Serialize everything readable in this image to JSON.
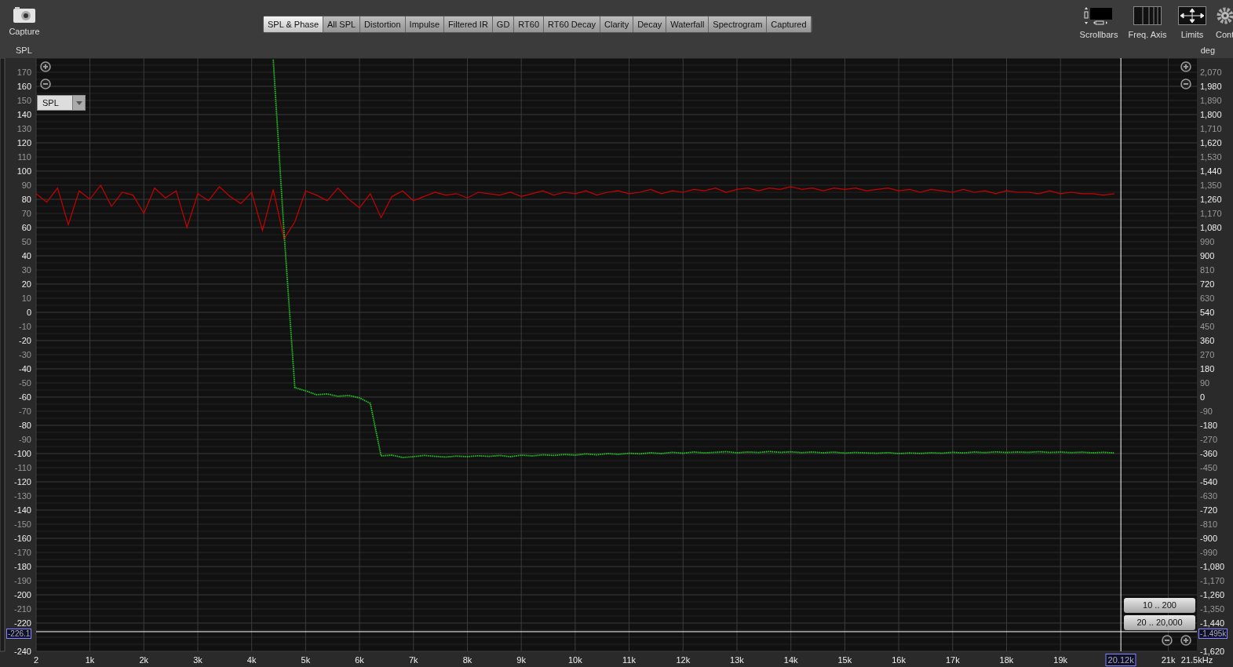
{
  "capture": {
    "label": "Capture"
  },
  "tabs": [
    {
      "label": "SPL & Phase",
      "selected": true
    },
    {
      "label": "All SPL",
      "selected": false
    },
    {
      "label": "Distortion",
      "selected": false
    },
    {
      "label": "Impulse",
      "selected": false
    },
    {
      "label": "Filtered IR",
      "selected": false
    },
    {
      "label": "GD",
      "selected": false
    },
    {
      "label": "RT60",
      "selected": false
    },
    {
      "label": "RT60 Decay",
      "selected": false
    },
    {
      "label": "Clarity",
      "selected": false
    },
    {
      "label": "Decay",
      "selected": false
    },
    {
      "label": "Waterfall",
      "selected": false
    },
    {
      "label": "Spectrogram",
      "selected": false
    },
    {
      "label": "Captured",
      "selected": false
    }
  ],
  "toolbar": [
    {
      "kind": "scrollbars",
      "label": "Scrollbars"
    },
    {
      "kind": "freq-axis",
      "label": "Freq. Axis"
    },
    {
      "kind": "limits",
      "label": "Limits"
    },
    {
      "kind": "controls",
      "label": "Cont"
    }
  ],
  "trace_select": {
    "value": "SPL"
  },
  "range_buttons": [
    "10 .. 200",
    "20 .. 20,000"
  ],
  "chart_data": {
    "type": "line",
    "ylabel": "SPL",
    "y2label": "deg",
    "xlim": [
      2,
      21530
    ],
    "ylim": [
      -240,
      180
    ],
    "y2lim": [
      -1620,
      2160
    ],
    "x": [
      2,
      200,
      400,
      600,
      800,
      1000,
      1200,
      1400,
      1600,
      1800,
      2000,
      2200,
      2400,
      2600,
      2800,
      3000,
      3200,
      3400,
      3600,
      3800,
      4000,
      4200,
      4400,
      4600,
      4800,
      5000,
      5200,
      5400,
      5600,
      5800,
      6000,
      6200,
      6400,
      6600,
      6800,
      7000,
      7200,
      7400,
      7600,
      7800,
      8000,
      8200,
      8400,
      8600,
      8800,
      9000,
      9200,
      9400,
      9600,
      9800,
      10000,
      10200,
      10400,
      10600,
      10800,
      11000,
      11200,
      11400,
      11600,
      11800,
      12000,
      12200,
      12400,
      12600,
      12800,
      13000,
      13200,
      13400,
      13600,
      13800,
      14000,
      14200,
      14400,
      14600,
      14800,
      15000,
      15200,
      15400,
      15600,
      15800,
      16000,
      16200,
      16400,
      16600,
      16800,
      17000,
      17200,
      17400,
      17600,
      17800,
      18000,
      18200,
      18400,
      18600,
      18800,
      19000,
      19200,
      19400,
      19600,
      19800,
      20000
    ],
    "series": [
      {
        "color": "#cc0000",
        "values": [
          84,
          78,
          88,
          62,
          86,
          80,
          90,
          75,
          85,
          83,
          70,
          88,
          81,
          86,
          60,
          84,
          79,
          89,
          82,
          77,
          85,
          58,
          87,
          52,
          64,
          86,
          83,
          79,
          88,
          80,
          74,
          84,
          67,
          82,
          86,
          79,
          82,
          85,
          83,
          84,
          81,
          85,
          84,
          83,
          85,
          82,
          84,
          86,
          83,
          85,
          84,
          86,
          83,
          85,
          86,
          84,
          85,
          87,
          84,
          86,
          85,
          87,
          86,
          88,
          85,
          87,
          88,
          86,
          88,
          87,
          89,
          87,
          88,
          86,
          88,
          87,
          88,
          86,
          87,
          88,
          86,
          87,
          85,
          87,
          86,
          85,
          87,
          85,
          86,
          84,
          86,
          85,
          85,
          84,
          86,
          84,
          85,
          84,
          84,
          83,
          84
        ]
      },
      {
        "axis": "y2",
        "color": "#22cc22",
        "line_style": "dotted",
        "values": [
          null,
          null,
          null,
          null,
          null,
          null,
          null,
          null,
          null,
          null,
          null,
          null,
          null,
          null,
          null,
          null,
          null,
          null,
          null,
          null,
          null,
          null,
          2150,
          1050,
          60,
          40,
          15,
          20,
          5,
          10,
          -5,
          -40,
          -375,
          -370,
          -385,
          -380,
          -372,
          -378,
          -382,
          -376,
          -380,
          -374,
          -378,
          -372,
          -380,
          -370,
          -375,
          -368,
          -372,
          -366,
          -370,
          -362,
          -368,
          -360,
          -365,
          -358,
          -362,
          -355,
          -360,
          -352,
          -358,
          -350,
          -356,
          -352,
          -348,
          -355,
          -350,
          -353,
          -347,
          -352,
          -349,
          -354,
          -350,
          -355,
          -351,
          -357,
          -353,
          -356,
          -358,
          -354,
          -360,
          -356,
          -359,
          -355,
          -358,
          -352,
          -356,
          -350,
          -354,
          -349,
          -353,
          -350,
          -352,
          -348,
          -353,
          -350,
          -354,
          -351,
          -355,
          -352,
          -356
        ]
      }
    ],
    "xticks": [
      {
        "value": 2,
        "label": "2"
      },
      {
        "value": 1000,
        "label": "1k"
      },
      {
        "value": 2000,
        "label": "2k"
      },
      {
        "value": 3000,
        "label": "3k"
      },
      {
        "value": 4000,
        "label": "4k"
      },
      {
        "value": 5000,
        "label": "5k"
      },
      {
        "value": 6000,
        "label": "6k"
      },
      {
        "value": 7000,
        "label": "7k"
      },
      {
        "value": 8000,
        "label": "8k"
      },
      {
        "value": 9000,
        "label": "9k"
      },
      {
        "value": 10000,
        "label": "10k"
      },
      {
        "value": 11000,
        "label": "11k"
      },
      {
        "value": 12000,
        "label": "12k"
      },
      {
        "value": 13000,
        "label": "13k"
      },
      {
        "value": 14000,
        "label": "14k"
      },
      {
        "value": 15000,
        "label": "15k"
      },
      {
        "value": 16000,
        "label": "16k"
      },
      {
        "value": 17000,
        "label": "17k"
      },
      {
        "value": 18000,
        "label": "18k"
      },
      {
        "value": 19000,
        "label": "19k"
      },
      {
        "value": 21000,
        "label": "21k"
      }
    ],
    "xlabel": "21.5kHz",
    "grid": true,
    "yticks": [
      170,
      160,
      150,
      140,
      130,
      120,
      110,
      100,
      90,
      80,
      70,
      60,
      50,
      40,
      30,
      20,
      10,
      0,
      -10,
      -20,
      -30,
      -40,
      -50,
      -60,
      -70,
      -80,
      -90,
      -100,
      -110,
      -120,
      -130,
      -140,
      -150,
      -160,
      -170,
      -180,
      -190,
      -200,
      -210,
      -220,
      -240
    ],
    "y2ticks": [
      {
        "value": 2070,
        "label": "2,070"
      },
      {
        "value": 1980,
        "label": "1,980"
      },
      {
        "value": 1890,
        "label": "1,890"
      },
      {
        "value": 1800,
        "label": "1,800"
      },
      {
        "value": 1710,
        "label": "1,710"
      },
      {
        "value": 1620,
        "label": "1,620"
      },
      {
        "value": 1530,
        "label": "1,530"
      },
      {
        "value": 1440,
        "label": "1,440"
      },
      {
        "value": 1350,
        "label": "1,350"
      },
      {
        "value": 1260,
        "label": "1,260"
      },
      {
        "value": 1170,
        "label": "1,170"
      },
      {
        "value": 1080,
        "label": "1,080"
      },
      {
        "value": 990,
        "label": "990"
      },
      {
        "value": 900,
        "label": "900"
      },
      {
        "value": 810,
        "label": "810"
      },
      {
        "value": 720,
        "label": "720"
      },
      {
        "value": 630,
        "label": "630"
      },
      {
        "value": 540,
        "label": "540"
      },
      {
        "value": 450,
        "label": "450"
      },
      {
        "value": 360,
        "label": "360"
      },
      {
        "value": 270,
        "label": "270"
      },
      {
        "value": 180,
        "label": "180"
      },
      {
        "value": 90,
        "label": "90"
      },
      {
        "value": 0,
        "label": "0"
      },
      {
        "value": -90,
        "label": "-90"
      },
      {
        "value": -180,
        "label": "-180"
      },
      {
        "value": -270,
        "label": "-270"
      },
      {
        "value": -360,
        "label": "-360"
      },
      {
        "value": -450,
        "label": "-450"
      },
      {
        "value": -540,
        "label": "-540"
      },
      {
        "value": -630,
        "label": "-630"
      },
      {
        "value": -720,
        "label": "-720"
      },
      {
        "value": -810,
        "label": "-810"
      },
      {
        "value": -900,
        "label": "-900"
      },
      {
        "value": -990,
        "label": "-990"
      },
      {
        "value": -1080,
        "label": "-1,080"
      },
      {
        "value": -1170,
        "label": "-1,170"
      },
      {
        "value": -1260,
        "label": "-1,260"
      },
      {
        "value": -1350,
        "label": "-1,350"
      },
      {
        "value": -1440,
        "label": "-1,440"
      },
      {
        "value": -1620,
        "label": "-1,620"
      }
    ],
    "ref_lines": [
      {
        "axis": "x",
        "value": 20120
      },
      {
        "axis": "y",
        "value": -226.1
      }
    ]
  },
  "cursor": {
    "x_readout": "20.12k",
    "y_readout": "-226.1",
    "y2_readout": "-1.495k"
  }
}
